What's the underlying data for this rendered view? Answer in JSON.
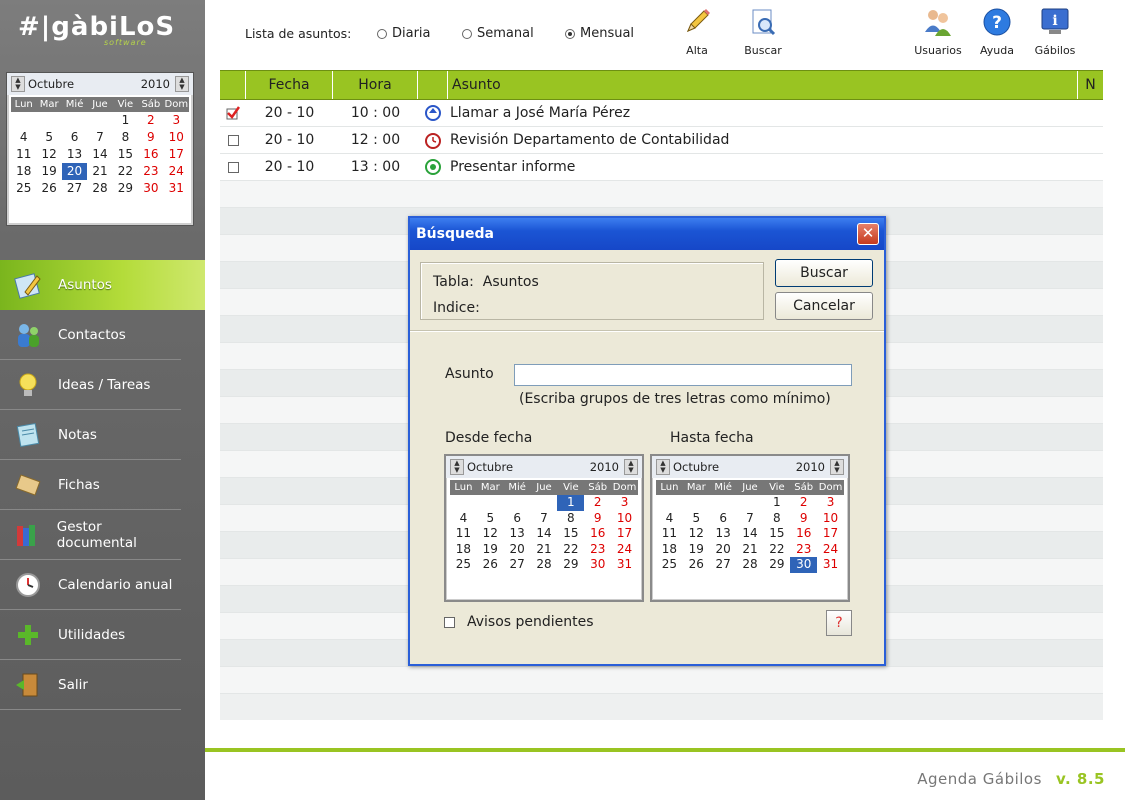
{
  "brand": {
    "logo": "#|gàbiLoS",
    "sub": "software"
  },
  "mini_calendar": {
    "month": "Octubre",
    "year": "2010",
    "weekdays": [
      "Lun",
      "Mar",
      "Mié",
      "Jue",
      "Vie",
      "Sáb",
      "Dom"
    ],
    "leading_blanks": 4,
    "days": 31,
    "selected": 20
  },
  "nav": [
    {
      "label": "Asuntos",
      "icon": "notepad-icon",
      "active": true
    },
    {
      "label": "Contactos",
      "icon": "contacts-icon"
    },
    {
      "label": "Ideas / Tareas",
      "icon": "lightbulb-icon"
    },
    {
      "label": "Notas",
      "icon": "notes-icon"
    },
    {
      "label": "Fichas",
      "icon": "cards-icon"
    },
    {
      "label": "Gestor documental",
      "icon": "books-icon"
    },
    {
      "label": "Calendario anual",
      "icon": "clock-icon"
    },
    {
      "label": "Utilidades",
      "icon": "plus-icon"
    },
    {
      "label": "Salir",
      "icon": "exit-door-icon"
    }
  ],
  "toolbar": {
    "list_label": "Lista de asuntos:",
    "radios": [
      {
        "label": "Diaria",
        "checked": false
      },
      {
        "label": "Semanal",
        "checked": false
      },
      {
        "label": "Mensual",
        "checked": true
      }
    ],
    "buttons": [
      {
        "label": "Alta",
        "icon": "pencil-icon"
      },
      {
        "label": "Buscar",
        "icon": "search-icon"
      },
      {
        "label": "Usuarios",
        "icon": "users-icon"
      },
      {
        "label": "Ayuda",
        "icon": "help-icon"
      },
      {
        "label": "Gábilos",
        "icon": "info-icon"
      }
    ]
  },
  "table": {
    "headers": [
      "Fecha",
      "Hora",
      "Asunto",
      "N"
    ],
    "rows": [
      {
        "checked": true,
        "fecha": "20 - 10",
        "hora": "10 : 00",
        "icon": "refresh-icon",
        "asunto": "Llamar a José María Pérez"
      },
      {
        "checked": false,
        "fecha": "20 - 10",
        "hora": "12 : 00",
        "icon": "alarm-clock-icon",
        "asunto": "Revisión Departamento de Contabilidad"
      },
      {
        "checked": false,
        "fecha": "20 - 10",
        "hora": "13 : 00",
        "icon": "target-icon",
        "asunto": "Presentar informe"
      }
    ]
  },
  "dialog": {
    "title": "Búsqueda",
    "tabla_label": "Tabla:",
    "tabla_value": "Asuntos",
    "indice_label": "Indice:",
    "buscar": "Buscar",
    "cancelar": "Cancelar",
    "asunto_label": "Asunto",
    "asunto_value": "",
    "hint": "(Escriba grupos de tres letras como mínimo)",
    "desde_label": "Desde fecha",
    "hasta_label": "Hasta fecha",
    "desde_cal": {
      "month": "Octubre",
      "year": "2010",
      "selected": 1
    },
    "hasta_cal": {
      "month": "Octubre",
      "year": "2010",
      "selected": 30
    },
    "avisos_label": "Avisos pendientes",
    "avisos_checked": false,
    "help": "?"
  },
  "status": {
    "app": "Agenda Gábilos",
    "version": "v. 8.5"
  },
  "colors": {
    "accent": "#99c422",
    "title_bar": "#1b55d4",
    "weekend": "#dd0000"
  }
}
